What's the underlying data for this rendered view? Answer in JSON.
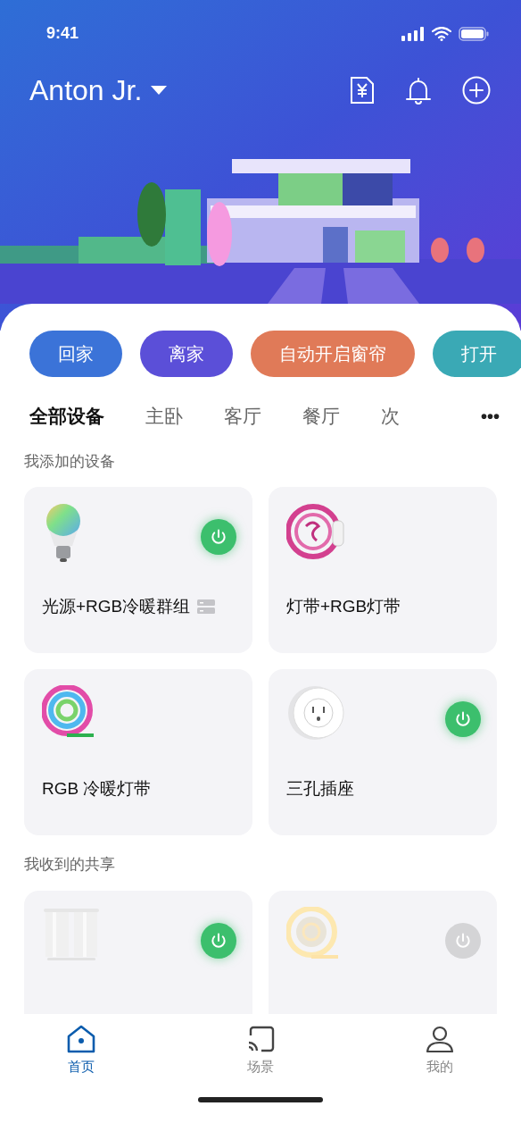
{
  "status_bar": {
    "time": "9:41"
  },
  "header": {
    "home_name": "Anton Jr."
  },
  "scenes": [
    {
      "label": "回家",
      "color": "#3b73d8"
    },
    {
      "label": "离家",
      "color": "#5b4fd8"
    },
    {
      "label": "自动开启窗帘",
      "color": "#e07a58"
    },
    {
      "label": "打开",
      "color": "#3aa9b5"
    }
  ],
  "rooms": [
    {
      "label": "全部设备",
      "selected": true
    },
    {
      "label": "主卧",
      "selected": false
    },
    {
      "label": "客厅",
      "selected": false
    },
    {
      "label": "餐厅",
      "selected": false
    },
    {
      "label": "次",
      "selected": false
    }
  ],
  "more_button": "•••",
  "sections": [
    {
      "title": "我添加的设备",
      "devices": [
        {
          "name": "光源+RGB冷暖群组",
          "kind": "bulb",
          "power": true,
          "group": true
        },
        {
          "name": "灯带+RGB灯带",
          "kind": "strip-pink",
          "group": false
        },
        {
          "name": "RGB 冷暖灯带",
          "kind": "strip-rgb",
          "group": false
        },
        {
          "name": "三孔插座",
          "kind": "socket",
          "power": true,
          "group": false
        }
      ]
    },
    {
      "title": "我收到的共享",
      "devices": [
        {
          "kind": "curtain",
          "power": true,
          "group": false
        },
        {
          "kind": "strip-yellow",
          "power": false,
          "group": false
        }
      ]
    }
  ],
  "tab_bar": [
    {
      "label": "首页",
      "kind": "home",
      "selected": true
    },
    {
      "label": "场景",
      "kind": "scene",
      "selected": false
    },
    {
      "label": "我的",
      "kind": "profile",
      "selected": false
    }
  ]
}
